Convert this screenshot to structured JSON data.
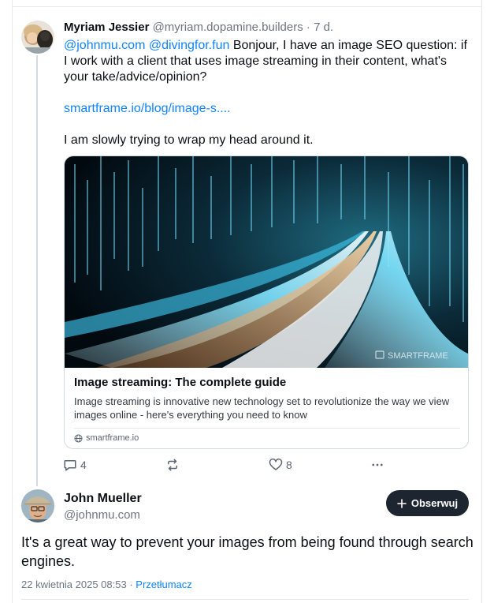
{
  "post1": {
    "author_name": "Myriam Jessier",
    "author_handle": "@myriam.dopamine.builders",
    "time_sep": " · ",
    "time": "7 d.",
    "mention1": "@johnmu.com",
    "mention2": "@divingfor.fun",
    "text1": " Bonjour, I have an image SEO question: if I work with a client that uses image streaming in their content, what's your take/advice/opinion?",
    "link": "smartframe.io/blog/image-s....",
    "text2": "I am slowly trying to wrap my head around it."
  },
  "card": {
    "title": "Image streaming: The complete guide",
    "description": "Image streaming is innovative new technology set to revolutionize the way we view images online - here's everything you need to know",
    "domain": "smartframe.io",
    "watermark": "SMARTFRAME"
  },
  "actions": {
    "reply_count": "4",
    "like_count": "8"
  },
  "post2": {
    "author_name": "John Mueller",
    "author_handle": "@johnmu.com",
    "follow_label": "Obserwuj",
    "text": "It's a great way to prevent your images from being found through search engines.",
    "timestamp": "22 kwietnia 2025 08:53",
    "meta_sep": " · ",
    "translate_label": "Przetłumacz"
  },
  "colors": {
    "accent": "#1083fe",
    "follow_bg": "#1d2530",
    "muted": "#6b7681"
  }
}
